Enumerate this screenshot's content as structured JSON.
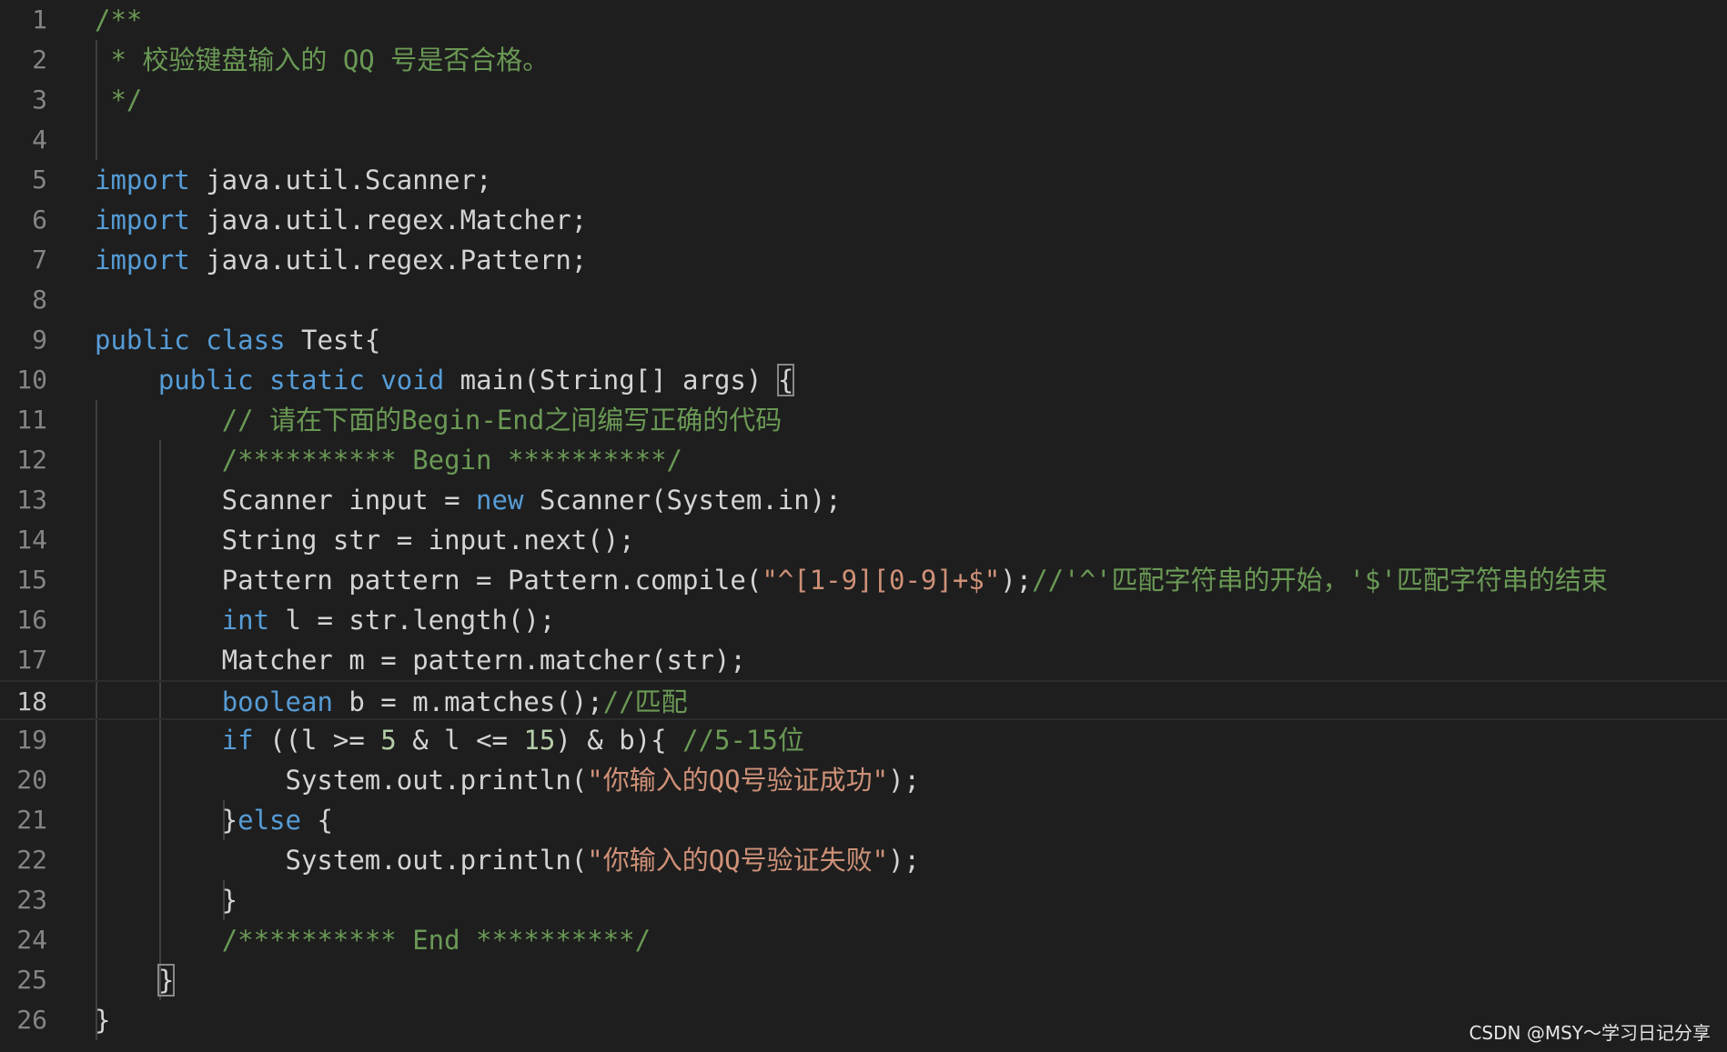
{
  "editor": {
    "theme": {
      "background": "#1e1e1e",
      "keyword": "#569cd6",
      "comment": "#6a9955",
      "string": "#ce9178",
      "number": "#b5cea8",
      "text": "#d4d4d4",
      "line_number": "#858585"
    },
    "current_line": 18,
    "lines": [
      {
        "num": "1",
        "tokens": [
          {
            "t": "/**",
            "c": "cm"
          }
        ]
      },
      {
        "num": "2",
        "tokens": [
          {
            "t": " * 校验键盘输入的 QQ 号是否合格。",
            "c": "cm"
          }
        ]
      },
      {
        "num": "3",
        "tokens": [
          {
            "t": " */",
            "c": "cm"
          }
        ]
      },
      {
        "num": "4",
        "tokens": []
      },
      {
        "num": "5",
        "tokens": [
          {
            "t": "import",
            "c": "kw"
          },
          {
            "t": " java.util.Scanner;",
            "c": "pl"
          }
        ]
      },
      {
        "num": "6",
        "tokens": [
          {
            "t": "import",
            "c": "kw"
          },
          {
            "t": " java.util.regex.Matcher;",
            "c": "pl"
          }
        ]
      },
      {
        "num": "7",
        "tokens": [
          {
            "t": "import",
            "c": "kw"
          },
          {
            "t": " java.util.regex.Pattern;",
            "c": "pl"
          }
        ]
      },
      {
        "num": "8",
        "tokens": []
      },
      {
        "num": "9",
        "tokens": [
          {
            "t": "public",
            "c": "kw"
          },
          {
            "t": " ",
            "c": "pl"
          },
          {
            "t": "class",
            "c": "kw"
          },
          {
            "t": " Test{",
            "c": "pl"
          }
        ]
      },
      {
        "num": "10",
        "tokens": [
          {
            "t": "    ",
            "c": "pl"
          },
          {
            "t": "public",
            "c": "kw"
          },
          {
            "t": " ",
            "c": "pl"
          },
          {
            "t": "static",
            "c": "kw"
          },
          {
            "t": " ",
            "c": "pl"
          },
          {
            "t": "void",
            "c": "kw"
          },
          {
            "t": " main(String[] args) ",
            "c": "pl"
          },
          {
            "t": "{",
            "c": "pl",
            "bm": true
          }
        ]
      },
      {
        "num": "11",
        "tokens": [
          {
            "t": "        ",
            "c": "pl"
          },
          {
            "t": "// 请在下面的Begin-End之间编写正确的代码",
            "c": "cm"
          }
        ]
      },
      {
        "num": "12",
        "tokens": [
          {
            "t": "        ",
            "c": "pl"
          },
          {
            "t": "/********** Begin **********/",
            "c": "cm"
          }
        ]
      },
      {
        "num": "13",
        "tokens": [
          {
            "t": "        Scanner input = ",
            "c": "pl"
          },
          {
            "t": "new",
            "c": "kw"
          },
          {
            "t": " Scanner(System.in);",
            "c": "pl"
          }
        ]
      },
      {
        "num": "14",
        "tokens": [
          {
            "t": "        String str = input.next();",
            "c": "pl"
          }
        ]
      },
      {
        "num": "15",
        "tokens": [
          {
            "t": "        Pattern pattern = Pattern.compile(",
            "c": "pl"
          },
          {
            "t": "\"^[1-9][0-9]+$\"",
            "c": "str"
          },
          {
            "t": ");",
            "c": "pl"
          },
          {
            "t": "//'^'匹配字符串的开始，'$'匹配字符串的结束",
            "c": "cm"
          }
        ]
      },
      {
        "num": "16",
        "tokens": [
          {
            "t": "        ",
            "c": "pl"
          },
          {
            "t": "int",
            "c": "kw"
          },
          {
            "t": " l = str.length();",
            "c": "pl"
          }
        ]
      },
      {
        "num": "17",
        "tokens": [
          {
            "t": "        Matcher m = pattern.matcher(str);",
            "c": "pl"
          }
        ]
      },
      {
        "num": "18",
        "tokens": [
          {
            "t": "        ",
            "c": "pl"
          },
          {
            "t": "boolean",
            "c": "kw"
          },
          {
            "t": " b = m.matches();",
            "c": "pl"
          },
          {
            "t": "//匹配",
            "c": "cm"
          }
        ]
      },
      {
        "num": "19",
        "tokens": [
          {
            "t": "        ",
            "c": "pl"
          },
          {
            "t": "if",
            "c": "kw"
          },
          {
            "t": " ((l >= ",
            "c": "pl"
          },
          {
            "t": "5",
            "c": "num"
          },
          {
            "t": " & l <= ",
            "c": "pl"
          },
          {
            "t": "15",
            "c": "num"
          },
          {
            "t": ") & b){ ",
            "c": "pl"
          },
          {
            "t": "//5-15位",
            "c": "cm"
          }
        ]
      },
      {
        "num": "20",
        "tokens": [
          {
            "t": "            System.out.println(",
            "c": "pl"
          },
          {
            "t": "\"你输入的QQ号验证成功\"",
            "c": "str"
          },
          {
            "t": ");",
            "c": "pl"
          }
        ]
      },
      {
        "num": "21",
        "tokens": [
          {
            "t": "        }",
            "c": "pl"
          },
          {
            "t": "else",
            "c": "kw"
          },
          {
            "t": " {",
            "c": "pl"
          }
        ]
      },
      {
        "num": "22",
        "tokens": [
          {
            "t": "            System.out.println(",
            "c": "pl"
          },
          {
            "t": "\"你输入的QQ号验证失败\"",
            "c": "str"
          },
          {
            "t": ");",
            "c": "pl"
          }
        ]
      },
      {
        "num": "23",
        "tokens": [
          {
            "t": "        }",
            "c": "pl"
          }
        ]
      },
      {
        "num": "24",
        "tokens": [
          {
            "t": "        ",
            "c": "pl"
          },
          {
            "t": "/********** End **********/",
            "c": "cm"
          }
        ]
      },
      {
        "num": "25",
        "tokens": [
          {
            "t": "    ",
            "c": "pl"
          },
          {
            "t": "}",
            "c": "pl",
            "bm": true
          }
        ]
      },
      {
        "num": "26",
        "tokens": [
          {
            "t": "}",
            "c": "pl"
          }
        ]
      }
    ]
  },
  "watermark": "CSDN @MSY～学习日记分享"
}
